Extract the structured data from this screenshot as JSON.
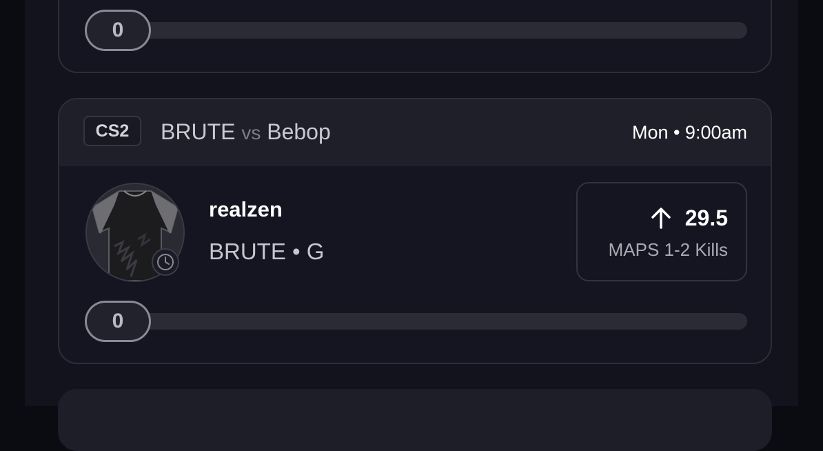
{
  "previous_card": {
    "progress": {
      "count_label": "0",
      "fraction": 0
    }
  },
  "match_card": {
    "game": "CS2",
    "team_home": "BRUTE",
    "vs_label": "vs",
    "team_away": "Bebop",
    "time": "Mon • 9:00am",
    "player": {
      "name": "realzen",
      "team_position": "BRUTE • G",
      "avatar_icon": "jersey-icon",
      "status_icon": "clock-icon"
    },
    "projection": {
      "direction_icon": "arrow-up-icon",
      "value": "29.5",
      "stat_label": "MAPS 1-2 Kills"
    },
    "progress": {
      "count_label": "0",
      "fraction": 0
    }
  },
  "colors": {
    "background": "#0b0b12",
    "card": "#151521",
    "card_header": "#1f1f2a",
    "border": "#2e2e3b",
    "text_primary": "#ffffff",
    "text_secondary": "#c6c6d0",
    "text_muted": "#a9a9b4",
    "progress_track": "#2b2b36"
  }
}
